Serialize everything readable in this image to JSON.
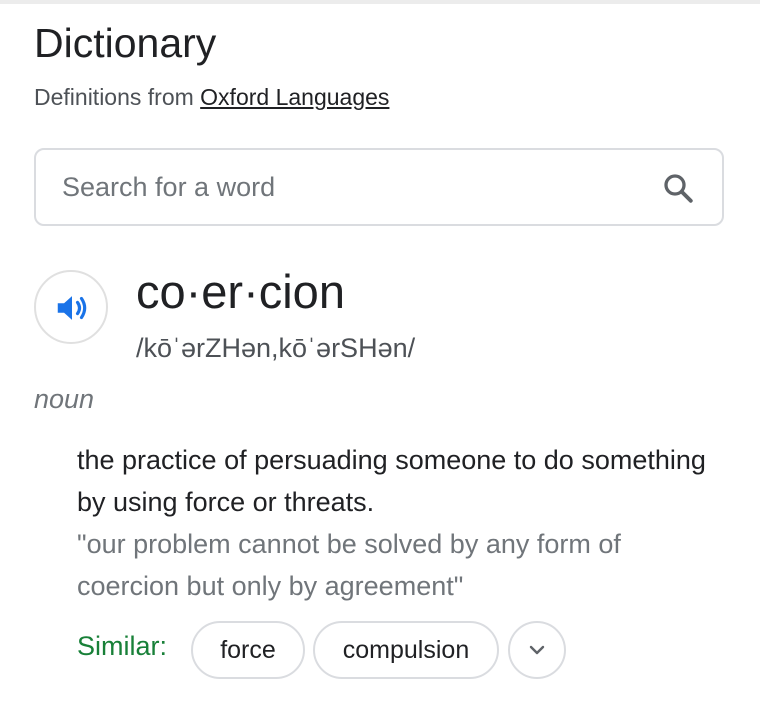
{
  "header": {
    "title": "Dictionary",
    "source_prefix": "Definitions from ",
    "source_link": "Oxford Languages"
  },
  "search": {
    "placeholder": "Search for a word",
    "value": "",
    "icon": "search-icon"
  },
  "entry": {
    "audio_icon": "speaker-icon",
    "headword": "co·er·cion",
    "phonetic": "/kōˈərZHən,kōˈərSHən/",
    "part_of_speech": "noun",
    "definition": "the practice of persuading someone to do something by using force or threats.",
    "example": "\"our problem cannot be solved by any form of coercion but only by agreement\"",
    "similar_label": "Similar:",
    "similar": [
      "force",
      "compulsion"
    ],
    "expand_icon": "chevron-down-icon"
  },
  "colors": {
    "accent_blue": "#1a73e8",
    "similar_green": "#188038",
    "border": "#dadce0"
  }
}
